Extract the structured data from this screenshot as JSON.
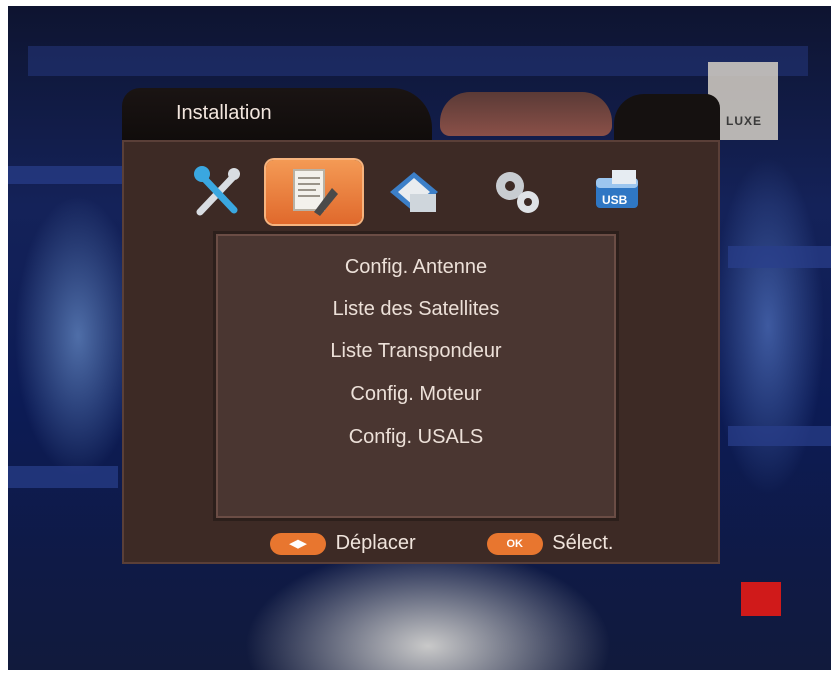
{
  "window": {
    "title": "Installation",
    "channel_logo_text": "LUXE"
  },
  "tabs": [
    {
      "icon": "tools-icon",
      "selected": false
    },
    {
      "icon": "installation-icon",
      "selected": true
    },
    {
      "icon": "channels-icon",
      "selected": false
    },
    {
      "icon": "settings-gears-icon",
      "selected": false
    },
    {
      "icon": "usb-icon",
      "selected": false
    }
  ],
  "menu": {
    "items": [
      {
        "label": "Config. Antenne"
      },
      {
        "label": "Liste des Satellites"
      },
      {
        "label": "Liste Transpondeur"
      },
      {
        "label": "Config. Moteur"
      },
      {
        "label": "Config. USALS"
      }
    ]
  },
  "footer": {
    "move_label": "Déplacer",
    "ok_key": "OK",
    "select_label": "Sélect."
  },
  "colors": {
    "accent": "#e8762f",
    "panel": "#3d2a25",
    "menu_bg": "#4a3631",
    "text": "#ece0d8"
  }
}
